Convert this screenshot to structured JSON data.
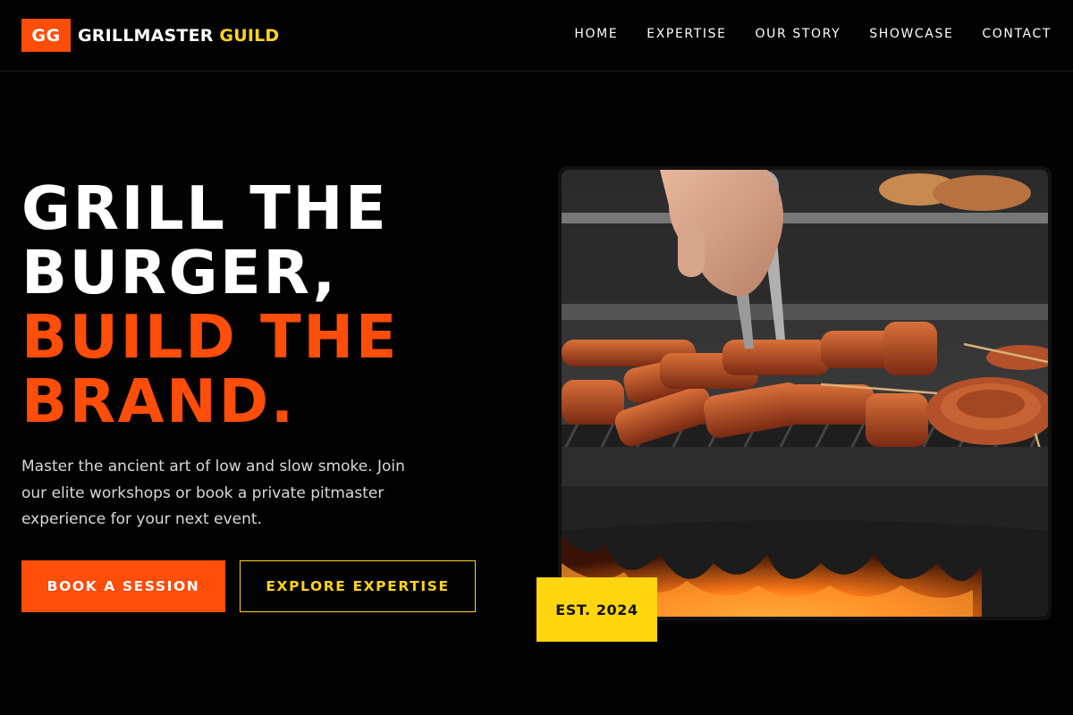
{
  "brand": {
    "badge": "GG",
    "name_main": "GRILLMASTER",
    "name_accent": "GUILD",
    "colors": {
      "primary": "#ff4d0a",
      "accent": "#ffd21f",
      "background": "#020202"
    }
  },
  "nav": {
    "items": [
      {
        "label": "HOME"
      },
      {
        "label": "EXPERTISE"
      },
      {
        "label": "OUR STORY"
      },
      {
        "label": "SHOWCASE"
      },
      {
        "label": "CONTACT"
      }
    ]
  },
  "hero": {
    "title_lines": [
      "GRILL THE",
      "BURGER,"
    ],
    "title_accent_lines": [
      "BUILD THE",
      "BRAND."
    ],
    "description": "Master the ancient art of low and slow smoke. Join our elite workshops or book a private pitmaster experience for your next event.",
    "primary_cta": "BOOK A SESSION",
    "secondary_cta": "EXPLORE EXPERTISE",
    "image_alt_icon": "grill-photo",
    "badge": "EST. 2024"
  }
}
